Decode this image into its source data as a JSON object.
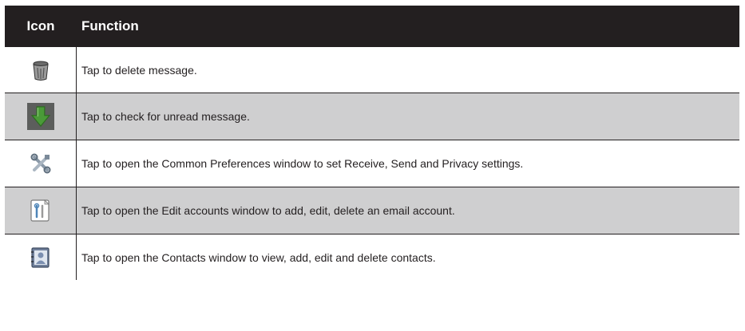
{
  "header": {
    "icon_col": "Icon",
    "function_col": "Function"
  },
  "rows": [
    {
      "icon": "trash-can-icon",
      "text": "Tap to delete message."
    },
    {
      "icon": "green-down-arrow-icon",
      "text": "Tap to check for unread message."
    },
    {
      "icon": "tools-wrench-screwdriver-icon",
      "text": "Tap to open the Common Preferences window to set Receive, Send and Privacy settings."
    },
    {
      "icon": "account-settings-icon",
      "text": "Tap to open the Edit accounts window to add, edit, delete an email account."
    },
    {
      "icon": "contacts-book-icon",
      "text": "Tap to open the Contacts window to view, add, edit and delete contacts."
    }
  ],
  "colors": {
    "header_bg": "#231f20",
    "alt_row_bg": "#cfcfd0",
    "arrow_green": "#4a9a38"
  }
}
